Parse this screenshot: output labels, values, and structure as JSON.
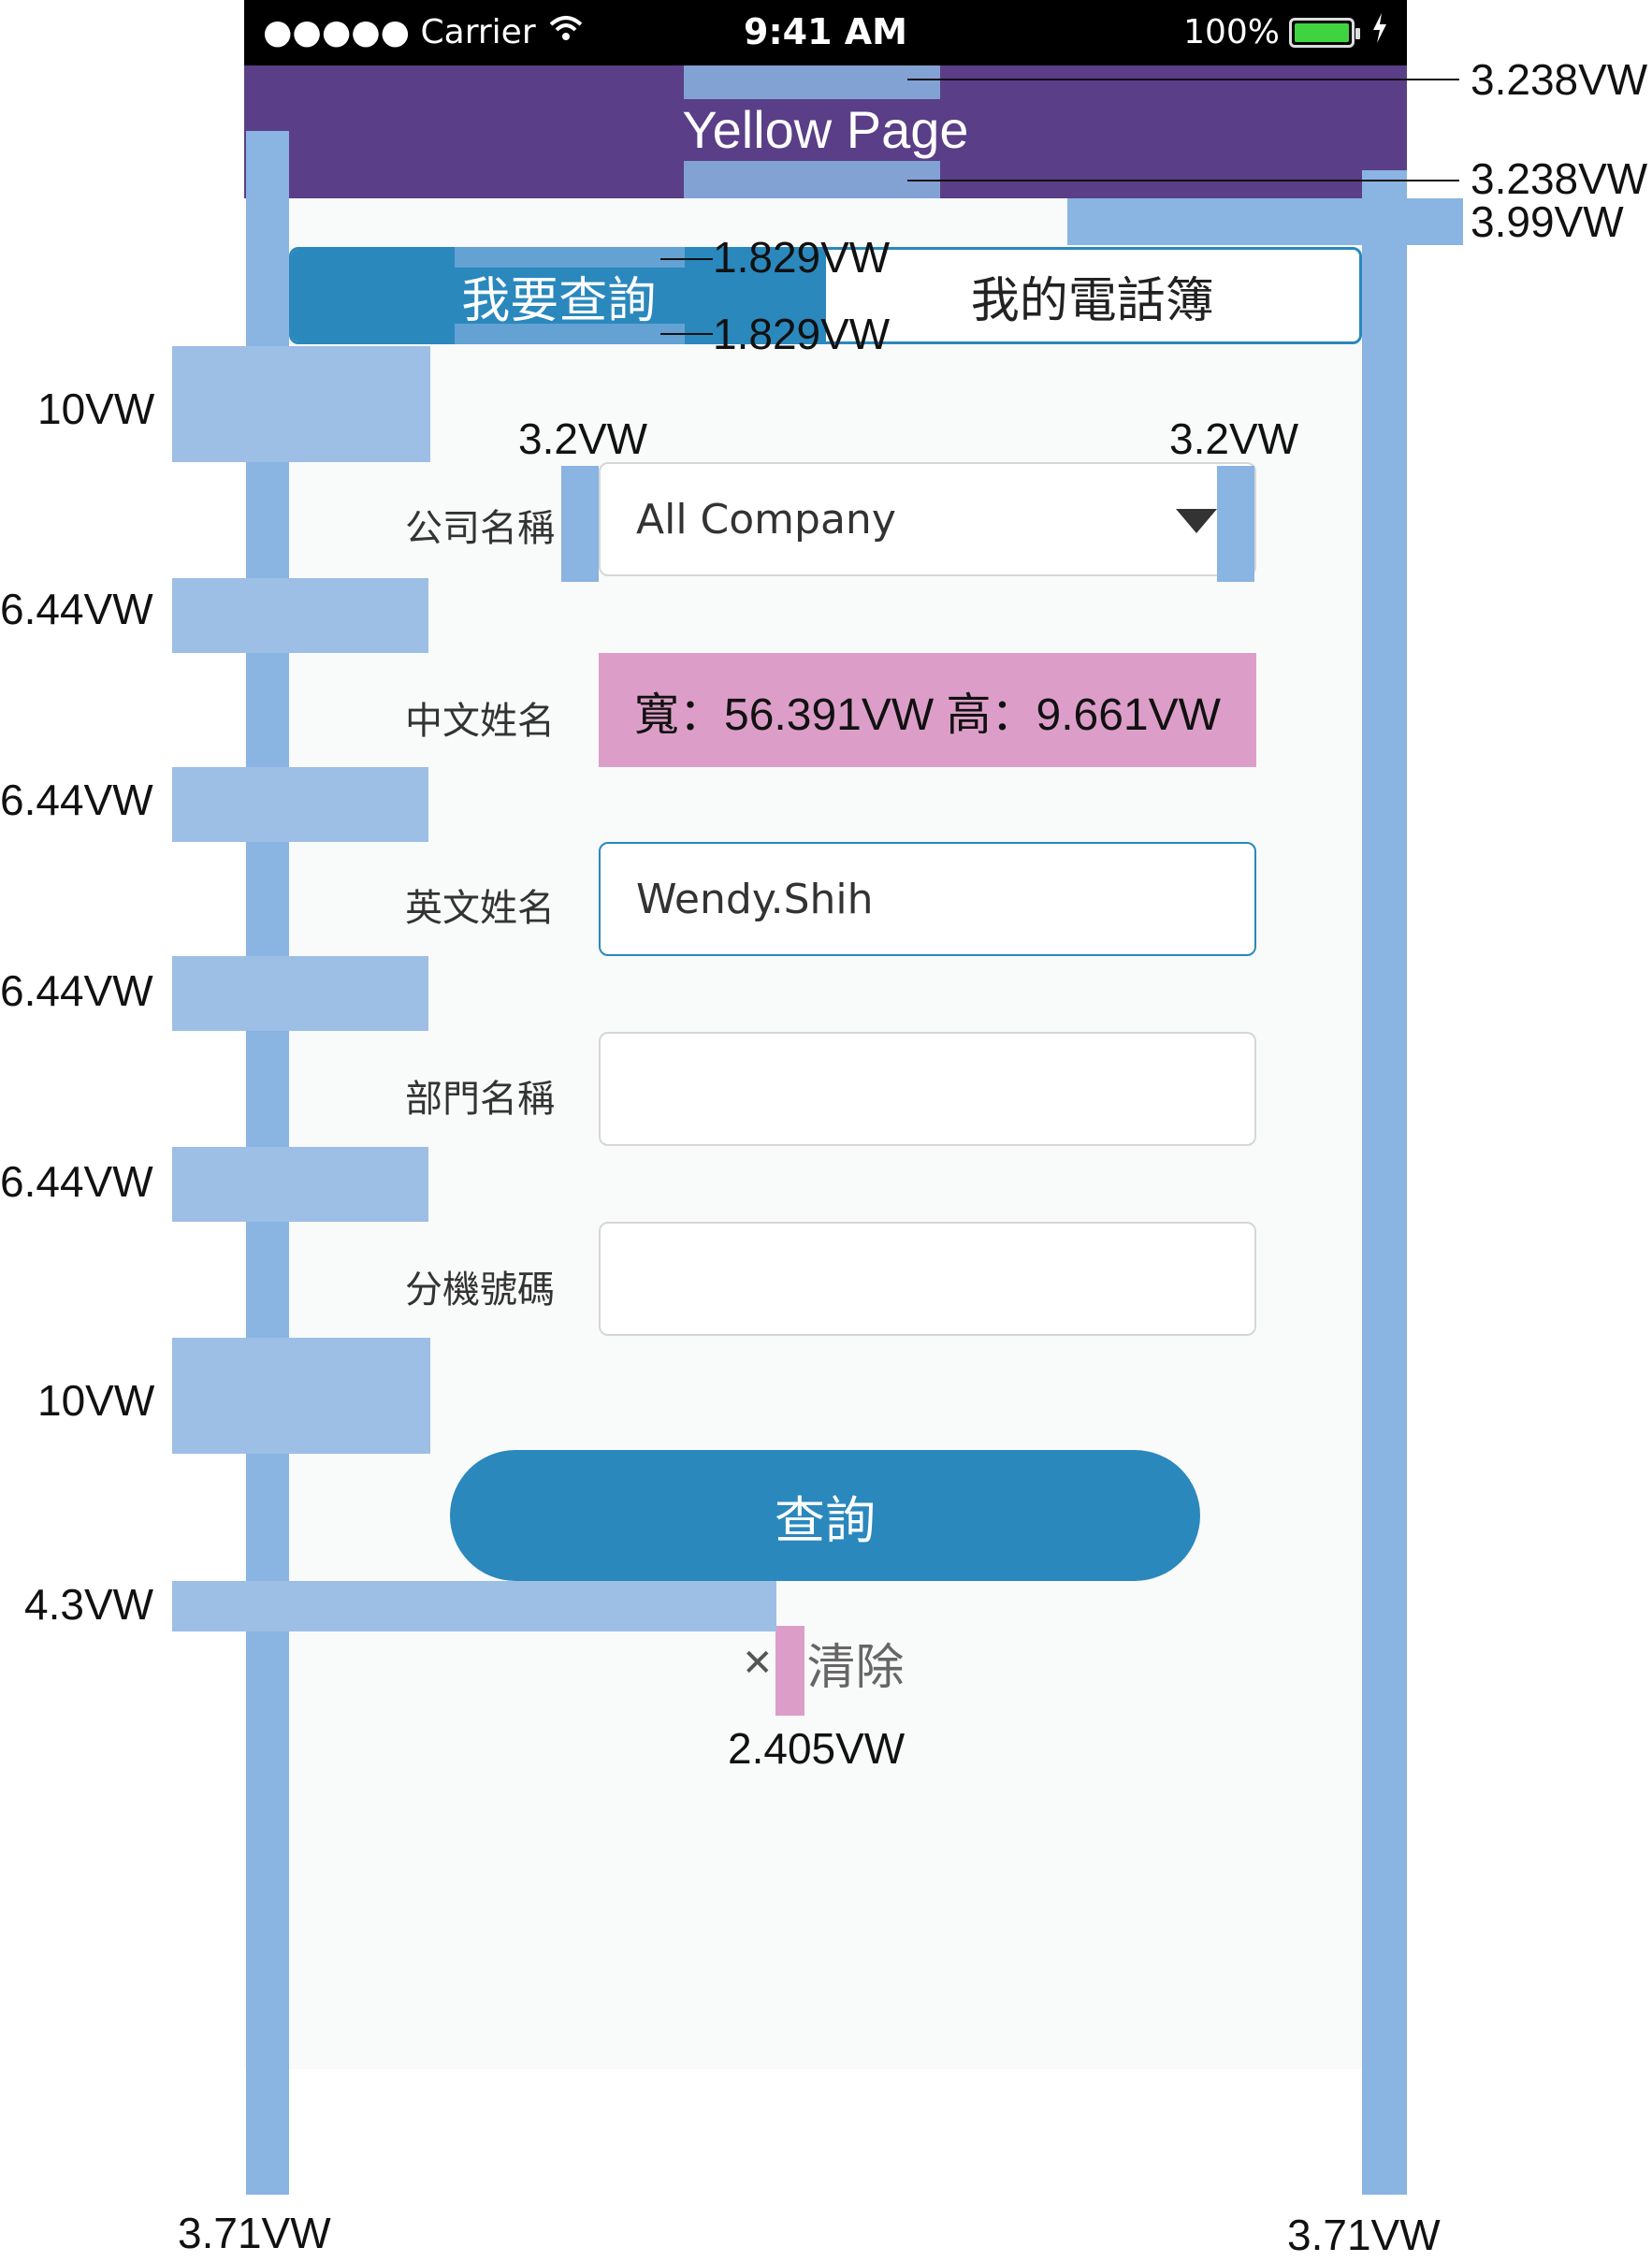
{
  "status_bar": {
    "carrier": "●●●●● Carrier",
    "time": "9:41 AM",
    "battery_percent": "100%"
  },
  "nav": {
    "title": "Yellow Page"
  },
  "tabs": [
    {
      "label": "我要查詢",
      "active": true
    },
    {
      "label": "我的電話簿",
      "active": false
    }
  ],
  "form": {
    "company": {
      "label": "公司名稱",
      "value": "All Company"
    },
    "chinese_name": {
      "label": "中文姓名",
      "overlay_text": "寬：56.391VW  高：9.661VW"
    },
    "english_name": {
      "label": "英文姓名",
      "value": "Wendy.Shih"
    },
    "department": {
      "label": "部門名稱",
      "value": ""
    },
    "extension": {
      "label": "分機號碼",
      "value": ""
    }
  },
  "buttons": {
    "query": "查詢",
    "clear_icon": "✕",
    "clear": "清除"
  },
  "annotations": {
    "nav_top": "3.238VW",
    "nav_bottom": "3.238VW",
    "nav_gap": "3.99VW",
    "tab_top": "1.829VW",
    "tab_bottom": "1.829VW",
    "form_top": "10VW",
    "select_left": "3.2VW",
    "select_right": "3.2VW",
    "row_gap_1": "6.44VW",
    "row_gap_2": "6.44VW",
    "row_gap_3": "6.44VW",
    "row_gap_4": "6.44VW",
    "button_top": "10VW",
    "clear_top": "4.3VW",
    "clear_gap": "2.405VW",
    "side_left": "3.71VW",
    "side_right": "3.71VW"
  },
  "colors": {
    "primary": "#2a88bd",
    "navbar": "#5a3e87",
    "guide": "#8ab4e1",
    "highlight": "#dc9ec8"
  }
}
